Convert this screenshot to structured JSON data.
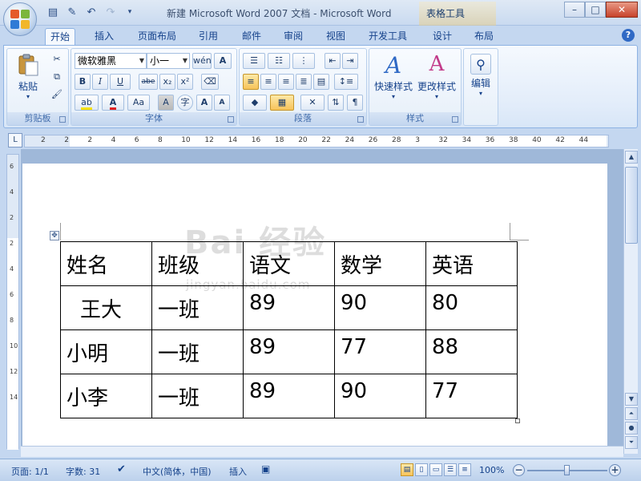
{
  "window": {
    "title": "新建 Microsoft Word 2007 文档 - Microsoft Word",
    "context_tools": "表格工具",
    "controls": [
      "–",
      "□",
      "✕"
    ]
  },
  "quick_access": [
    "save-icon",
    "edit-icon",
    "undo-icon",
    "redo-icon",
    "customize-icon"
  ],
  "tabs": [
    {
      "label": "开始",
      "active": true
    },
    {
      "label": "插入"
    },
    {
      "label": "页面布局"
    },
    {
      "label": "引用"
    },
    {
      "label": "邮件"
    },
    {
      "label": "审阅"
    },
    {
      "label": "视图"
    },
    {
      "label": "开发工具"
    },
    {
      "label": "设计"
    },
    {
      "label": "布局"
    }
  ],
  "ribbon": {
    "clipboard": {
      "label": "剪贴板",
      "paste": "粘贴"
    },
    "font": {
      "label": "字体",
      "font_name": "微软雅黑",
      "font_size": "小一",
      "buttons": [
        "B",
        "I",
        "U",
        "abe",
        "x₂",
        "x²",
        "Aa",
        "A",
        "A",
        "字",
        "A",
        "A"
      ]
    },
    "paragraph": {
      "label": "段落"
    },
    "styles": {
      "label": "样式",
      "quick_styles": "快速样式",
      "change_styles": "更改样式"
    },
    "editing": {
      "label": "编辑"
    }
  },
  "ruler": {
    "h_numbers": [
      "2",
      "2",
      "2",
      "4",
      "6",
      "8",
      "10",
      "12",
      "14",
      "16",
      "18",
      "20",
      "22",
      "24",
      "26",
      "28",
      "3",
      "32",
      "34",
      "36",
      "38",
      "40",
      "42",
      "44"
    ],
    "v_numbers": [
      "6",
      "4",
      "2",
      "2",
      "4",
      "6",
      "8",
      "10",
      "12",
      "14"
    ],
    "corner": "L"
  },
  "table": {
    "rows": [
      [
        "姓名",
        "班级",
        "语文",
        "数学",
        "英语"
      ],
      [
        "王大",
        "一班",
        "89",
        "90",
        "80"
      ],
      [
        "小明",
        "一班",
        "89",
        "77",
        "88"
      ],
      [
        "小李",
        "一班",
        "89",
        "90",
        "77"
      ]
    ]
  },
  "watermark": {
    "logo": "Bai 经验",
    "url": "jingyan.baidu.com"
  },
  "statusbar": {
    "page": "页面: 1/1",
    "words": "字数: 31",
    "language": "中文(简体，中国)",
    "insert_mode": "插入",
    "zoom": "100%"
  },
  "colors": {
    "ribbon_text": "#15428b",
    "accent": "#2f69c5"
  }
}
